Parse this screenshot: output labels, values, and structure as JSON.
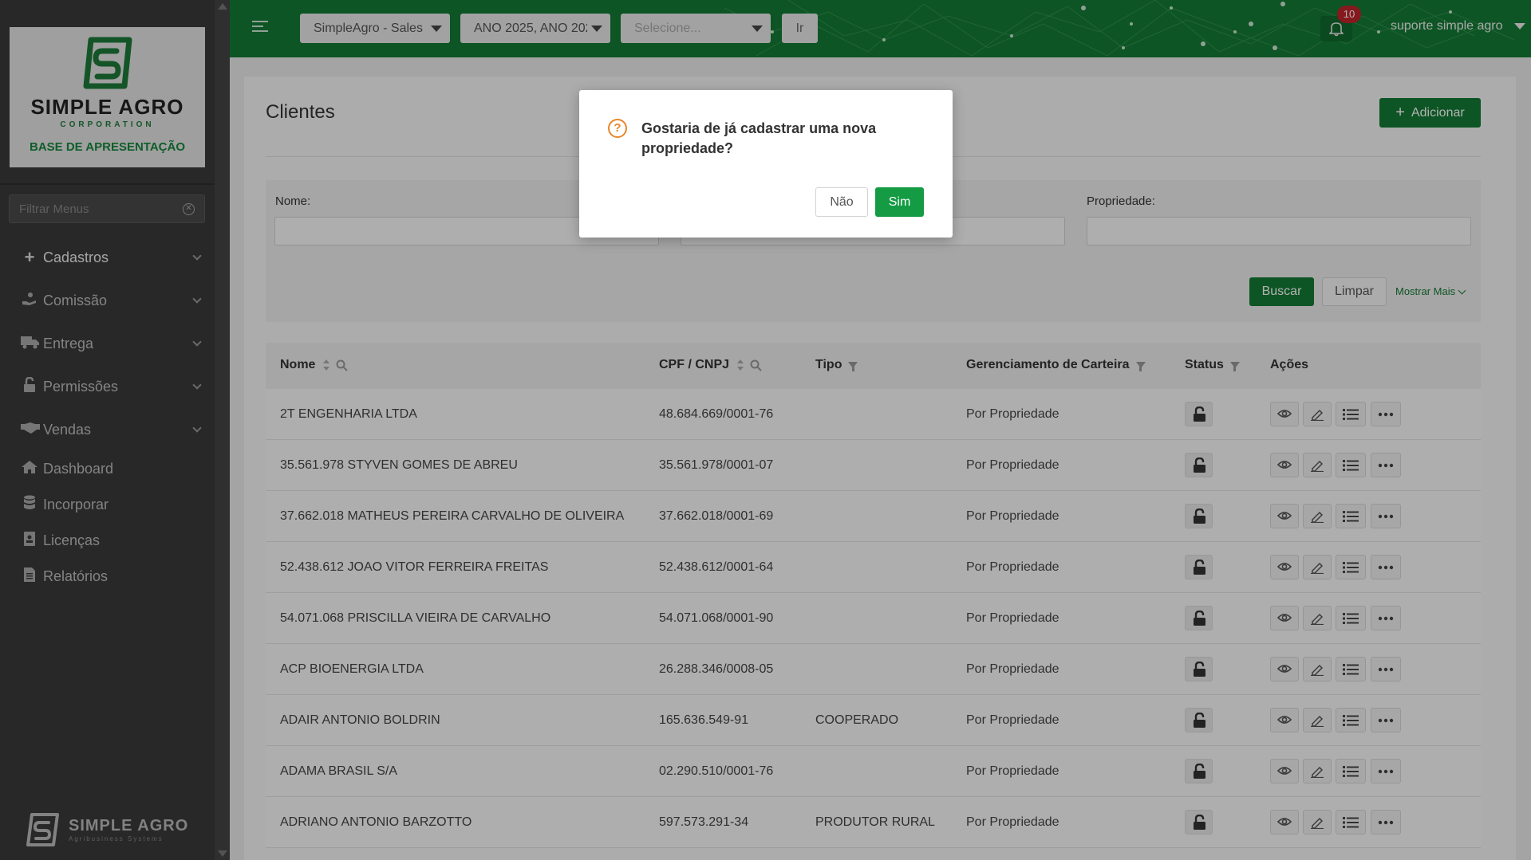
{
  "sidebar": {
    "logo": {
      "title": "SIMPLE AGRO",
      "subtitle": "CORPORATION",
      "base": "BASE DE APRESENTAÇÃO"
    },
    "filter_placeholder": "Filtrar Menus",
    "items": [
      {
        "label": "Cadastros",
        "icon": "plus-icon",
        "expandable": true
      },
      {
        "label": "Comissão",
        "icon": "hand-coin-icon",
        "expandable": true
      },
      {
        "label": "Entrega",
        "icon": "truck-icon",
        "expandable": true
      },
      {
        "label": "Permissões",
        "icon": "lock-icon",
        "expandable": true
      },
      {
        "label": "Vendas",
        "icon": "handshake-icon",
        "expandable": true
      },
      {
        "label": "Dashboard",
        "icon": "home-icon",
        "expandable": false
      },
      {
        "label": "Incorporar",
        "icon": "database-icon",
        "expandable": false
      },
      {
        "label": "Licenças",
        "icon": "id-card-icon",
        "expandable": false
      },
      {
        "label": "Relatórios",
        "icon": "report-icon",
        "expandable": false
      }
    ],
    "bottom_logo": {
      "title": "SIMPLE AGRO",
      "subtitle": "Agribusiness Systems"
    }
  },
  "topbar": {
    "company_select": "SimpleAgro - Sales",
    "year_select": "ANO 2025, ANO 202",
    "third_select_placeholder": "Selecione...",
    "go_label": "Ir",
    "notifications_count": "10",
    "user_name": "suporte simple agro"
  },
  "page": {
    "title": "Clientes",
    "add_label": "Adicionar"
  },
  "filters": {
    "nome_label": "Nome:",
    "propriedade_label": "Propriedade:",
    "buscar_label": "Buscar",
    "limpar_label": "Limpar",
    "mostrar_label": "Mostrar Mais"
  },
  "table": {
    "columns": [
      "Nome",
      "CPF / CNPJ",
      "Tipo",
      "Gerenciamento de Carteira",
      "Status",
      "Ações"
    ],
    "rows": [
      {
        "nome": "2T ENGENHARIA LTDA",
        "doc": "48.684.669/0001-76",
        "tipo": "",
        "ger": "Por Propriedade"
      },
      {
        "nome": "35.561.978 STYVEN GOMES DE ABREU",
        "doc": "35.561.978/0001-07",
        "tipo": "",
        "ger": "Por Propriedade"
      },
      {
        "nome": "37.662.018 MATHEUS PEREIRA CARVALHO DE OLIVEIRA",
        "doc": "37.662.018/0001-69",
        "tipo": "",
        "ger": "Por Propriedade"
      },
      {
        "nome": "52.438.612 JOAO VITOR FERREIRA FREITAS",
        "doc": "52.438.612/0001-64",
        "tipo": "",
        "ger": "Por Propriedade"
      },
      {
        "nome": "54.071.068 PRISCILLA VIEIRA DE CARVALHO",
        "doc": "54.071.068/0001-90",
        "tipo": "",
        "ger": "Por Propriedade"
      },
      {
        "nome": "ACP BIOENERGIA LTDA",
        "doc": "26.288.346/0008-05",
        "tipo": "",
        "ger": "Por Propriedade"
      },
      {
        "nome": "ADAIR ANTONIO BOLDRIN",
        "doc": "165.636.549-91",
        "tipo": "COOPERADO",
        "ger": "Por Propriedade"
      },
      {
        "nome": "ADAMA BRASIL S/A",
        "doc": "02.290.510/0001-76",
        "tipo": "",
        "ger": "Por Propriedade"
      },
      {
        "nome": "ADRIANO ANTONIO BARZOTTO",
        "doc": "597.573.291-34",
        "tipo": "PRODUTOR RURAL",
        "ger": "Por Propriedade"
      }
    ]
  },
  "modal": {
    "message": "Gostaria de já cadastrar uma nova propriedade?",
    "no_label": "Não",
    "yes_label": "Sim"
  },
  "colors": {
    "brand_green": "#137a34",
    "sidebar_bg": "#3a3a3a",
    "warning_orange": "#e8862a",
    "badge_red": "#c0252b"
  }
}
